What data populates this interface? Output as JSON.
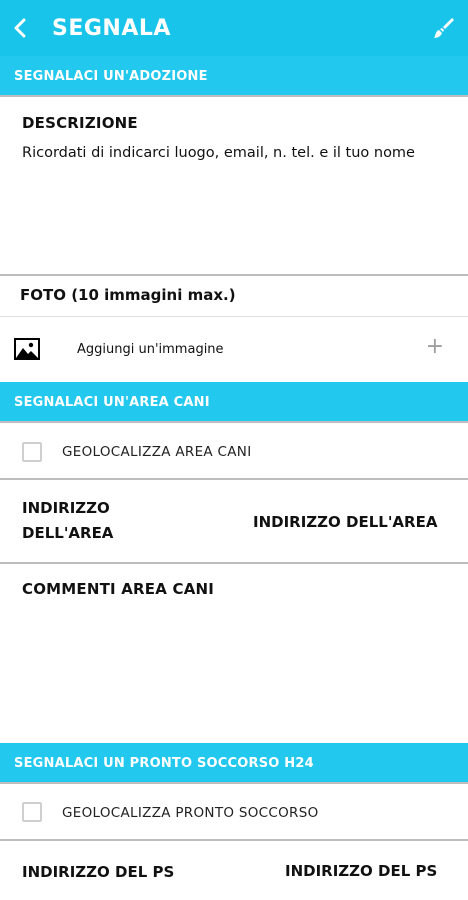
{
  "appbar": {
    "title": "SEGNALA",
    "back_icon": "chevron-left-icon",
    "action_icon": "brush-icon",
    "color": "#19c4ea"
  },
  "adoption": {
    "header": "SEGNALACI UN'ADOZIONE",
    "description_label": "DESCRIZIONE",
    "description_placeholder": "Ricordati di indicarci luogo, email, n. tel. e il tuo nome",
    "photo_label": "FOTO (10 immagini max.)",
    "add_image_label": "Aggiungi un'immagine",
    "add_image_icon": "image-icon",
    "add_symbol": "+"
  },
  "dog_area": {
    "header": "SEGNALACI UN'AREA CANI",
    "geolocate_label": "GEOLOCALIZZA AREA CANI",
    "address_label_line1": "INDIRIZZO",
    "address_label_line2": "DELL'AREA",
    "address_value": "INDIRIZZO DELL'AREA",
    "comments_label": "COMMENTI AREA CANI"
  },
  "first_aid": {
    "header": "SEGNALACI UN PRONTO SOCCORSO H24",
    "geolocate_label": "GEOLOCALIZZA PRONTO SOCCORSO",
    "address_label": "INDIRIZZO DEL PS",
    "address_value": "INDIRIZZO DEL PS"
  }
}
